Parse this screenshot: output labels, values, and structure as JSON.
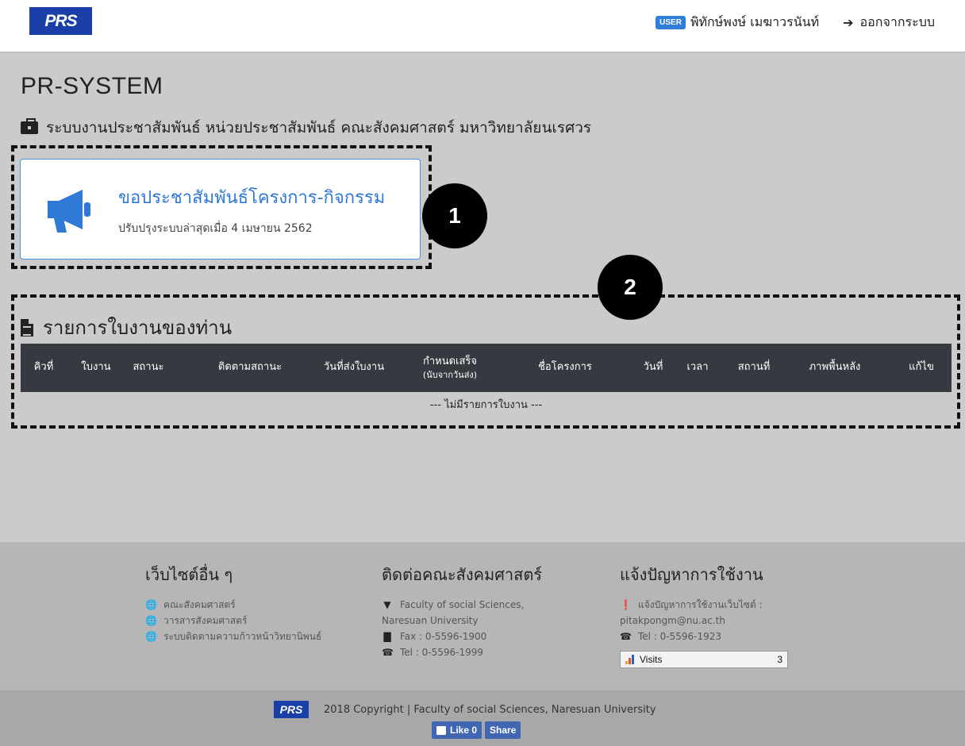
{
  "navbar": {
    "logo": "PRS",
    "user_badge": "USER",
    "user_name": "พิทักษ์พงษ์ เมฆาวรนันท์",
    "logout_label": "ออกจากระบบ"
  },
  "header": {
    "title": "PR-SYSTEM",
    "subtitle": "ระบบงานประชาสัมพันธ์ หน่วยประชาสัมพันธ์ คณะสังคมศาสตร์ มหาวิทยาลัยนเรศวร"
  },
  "markers": {
    "one": "1",
    "two": "2"
  },
  "card": {
    "title": "ขอประชาสัมพันธ์โครงการ-กิจกรรม",
    "subtitle": "ปรับปรุงระบบล่าสุดเมื่อ 4 เมษายน 2562",
    "accent_color": "#2e79d6"
  },
  "worklist": {
    "title": "รายการใบงานของท่าน",
    "columns": [
      "คิวที่",
      "ใบงาน",
      "สถานะ",
      "ติดตามสถานะ",
      "วันที่ส่งใบงาน",
      "กำหนดเสร็จ",
      "ชื่อโครงการ",
      "วันที่",
      "เวลา",
      "สถานที่",
      "ภาพพื้นหลัง",
      "แก้ไข"
    ],
    "deadline_note": "(นับจากวันส่ง)",
    "empty_text": "--- ไม่มีรายการใบงาน ---"
  },
  "footer": {
    "col1": {
      "heading": "เว็บไซต์อื่น ๆ",
      "links": [
        "คณะสังคมศาสตร์",
        "วารสารสังคมศาสตร์",
        "ระบบติดตามความก้าวหน้าวิทยานิพนธ์"
      ]
    },
    "col2": {
      "heading": "ติดต่อคณะสังคมศาสตร์",
      "address_1": "Faculty of social Sciences,",
      "address_2": "Naresuan University",
      "fax": "Fax : 0-5596-1900",
      "tel": "Tel : 0-5596-1999"
    },
    "col3": {
      "heading": "แจ้งปัญหาการใช้งาน",
      "report_label": "แจ้งปัญหาการใช้งานเว็บไซต์ :",
      "email": "pitakpongm@nu.ac.th",
      "tel": "Tel : 0-5596-1923",
      "visits_label": "Visits",
      "visits_count": "3"
    }
  },
  "bottom": {
    "logo": "PRS",
    "copyright": "2018 Copyright | Faculty of social Sciences, Naresuan University",
    "like_label": "Like",
    "like_count": "0",
    "share_label": "Share"
  }
}
